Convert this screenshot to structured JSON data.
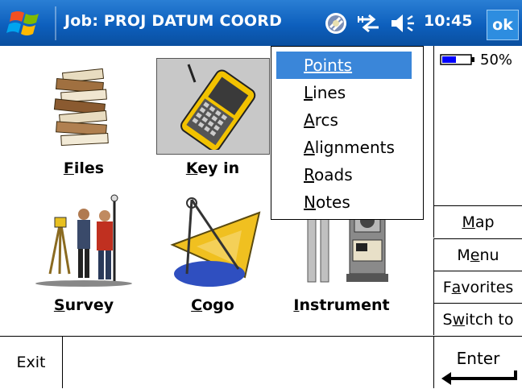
{
  "titlebar": {
    "title": "Job: PROJ DATUM COORD",
    "clock": "10:45",
    "ok_label": "ok",
    "icons": [
      "windows-start-icon",
      "gps-satellite-icon",
      "connectivity-icon",
      "volume-icon"
    ]
  },
  "battery": {
    "percent_label": "50%",
    "level": 0.5
  },
  "desktop": {
    "items": [
      {
        "label": "Files",
        "icon": "files-icon"
      },
      {
        "label": "Key in",
        "icon": "controller-icon"
      },
      {
        "label": "Survey",
        "icon": "survey-icon"
      },
      {
        "label": "Cogo",
        "icon": "cogo-icon"
      },
      {
        "label": "Instrument",
        "icon": "instrument-icon"
      }
    ]
  },
  "menu": {
    "items": [
      {
        "label": "Points",
        "selected": true
      },
      {
        "label": "Lines",
        "selected": false
      },
      {
        "label": "Arcs",
        "selected": false
      },
      {
        "label": "Alignments",
        "selected": false
      },
      {
        "label": "Roads",
        "selected": false
      },
      {
        "label": "Notes",
        "selected": false
      }
    ]
  },
  "side_buttons": [
    "Map",
    "Menu",
    "Favorites",
    "Switch to"
  ],
  "bottom": {
    "exit_label": "Exit",
    "enter_label": "Enter"
  },
  "colors": {
    "title_bar": "#0d5fbd",
    "menu_selection": "#3a86d9",
    "key_in_bg": "#c8c8c8"
  }
}
